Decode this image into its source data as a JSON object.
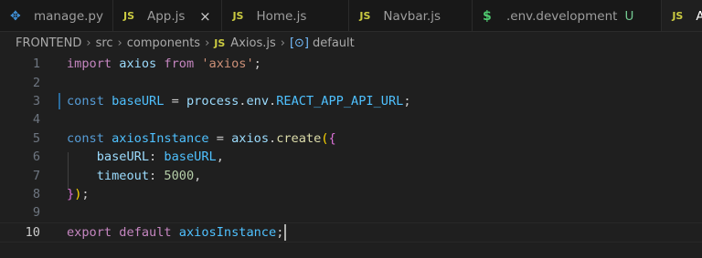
{
  "tabs": [
    {
      "icon": "python-icon",
      "label": "manage.py"
    },
    {
      "icon": "js-icon",
      "label": "App.js",
      "close": "×"
    },
    {
      "icon": "js-icon",
      "label": "Home.js"
    },
    {
      "icon": "js-icon",
      "label": "Navbar.js"
    },
    {
      "icon": "env-icon",
      "label": ".env.development",
      "badge": "U"
    },
    {
      "icon": "js-icon",
      "label": "Ax"
    }
  ],
  "icon_glyphs": {
    "js": "JS",
    "env": "$",
    "symbol": "[⊙]"
  },
  "breadcrumb": [
    "FRONTEND",
    "src",
    "components",
    "Axios.js",
    "default"
  ],
  "editor": {
    "line_numbers": [
      "1",
      "2",
      "3",
      "4",
      "5",
      "6",
      "7",
      "8",
      "9",
      "10"
    ],
    "current_line": "10",
    "lines": {
      "l1": {
        "import": "import",
        "axios": "axios",
        "from": "from",
        "str": "'axios'",
        "semi": ";"
      },
      "l3": {
        "const": "const",
        "name": "baseURL",
        "eq": " = ",
        "process": "process",
        "dot1": ".",
        "env": "env",
        "dot2": ".",
        "key": "REACT_APP_API_URL",
        "semi": ";"
      },
      "l5": {
        "const": "const",
        "name": "axiosInstance",
        "eq": " = ",
        "axios": "axios",
        "dot": ".",
        "create": "create",
        "paren": "(",
        "brace": "{"
      },
      "l6": {
        "key": "baseURL",
        "colon": ": ",
        "val": "baseURL",
        "comma": ","
      },
      "l7": {
        "key": "timeout",
        "colon": ": ",
        "val": "5000",
        "comma": ","
      },
      "l8": {
        "brace": "}",
        "paren": ")",
        "semi": ";"
      },
      "l10": {
        "export": "export",
        "default": "default",
        "name": "axiosInstance",
        "semi": ";"
      }
    }
  }
}
